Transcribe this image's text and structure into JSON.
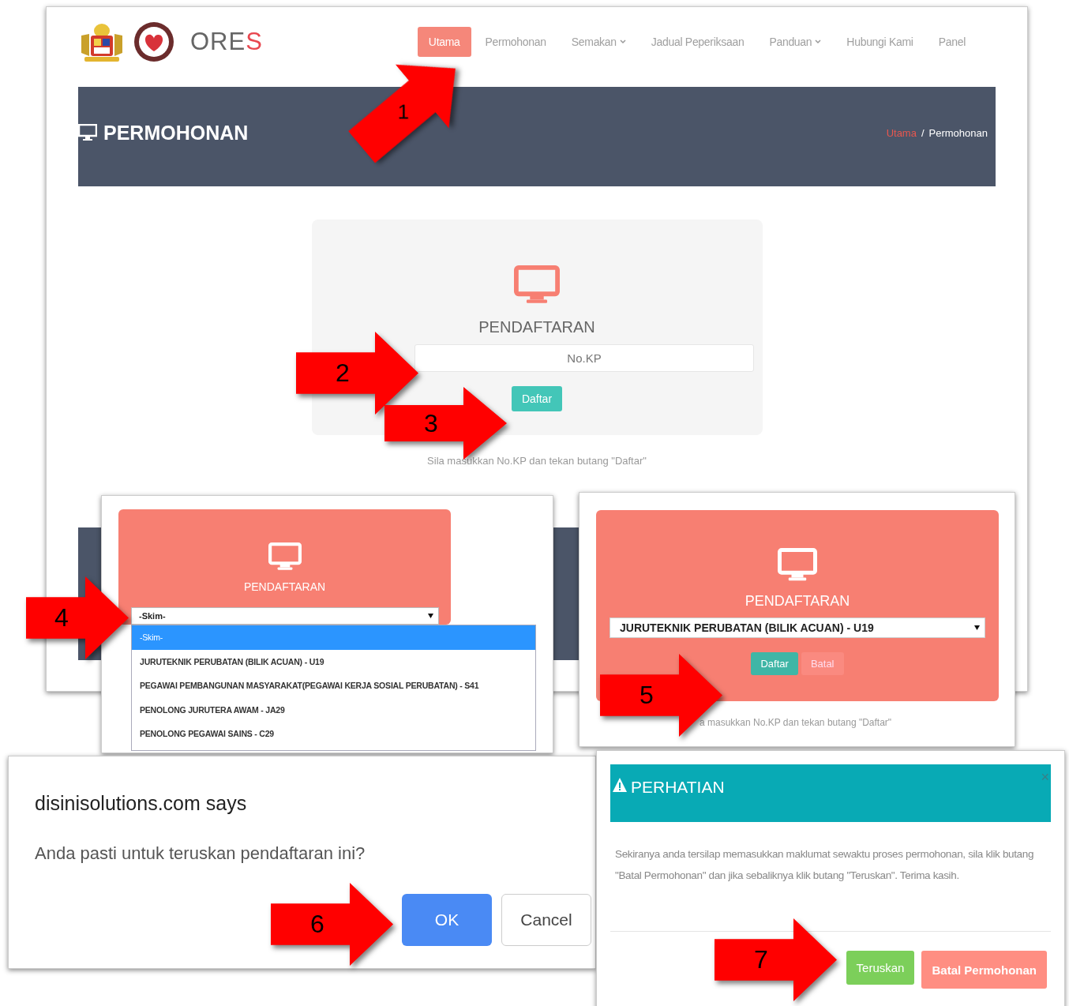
{
  "page": {
    "brand": "ORE",
    "brand_accent": "S",
    "nav": [
      {
        "label": "Utama",
        "selected": true,
        "dropdown": false
      },
      {
        "label": "Permohonan",
        "selected": false,
        "dropdown": false
      },
      {
        "label": "Semakan",
        "selected": false,
        "dropdown": true
      },
      {
        "label": "Jadual Peperiksaan",
        "selected": false,
        "dropdown": false
      },
      {
        "label": "Panduan",
        "selected": false,
        "dropdown": true
      },
      {
        "label": "Hubungi Kami",
        "selected": false,
        "dropdown": false
      },
      {
        "label": "Panel",
        "selected": false,
        "dropdown": false
      }
    ],
    "banner": {
      "title": "PERMOHONAN",
      "breadcrumb": [
        {
          "label": "Utama",
          "kind": "link"
        },
        {
          "label": "/",
          "kind": "separator"
        },
        {
          "label": "Permohonan",
          "kind": "current"
        }
      ]
    },
    "card": {
      "title": "PENDAFTARAN",
      "field": {
        "placeholder": "No.KP"
      },
      "button": "Daftar"
    },
    "hint": "Sila masukkan No.KP dan tekan butang \"Daftar\""
  },
  "dropdown_view": {
    "title": "PENDAFTARAN",
    "select_value": "-Skim-",
    "options": [
      {
        "label": "-Skim-",
        "selected": true
      },
      {
        "label": "JURUTEKNIK PERUBATAN (BILIK ACUAN) - U19",
        "selected": false
      },
      {
        "label": "PEGAWAI PEMBANGUNAN MASYARAKAT(PEGAWAI KERJA SOSIAL PERUBATAN) - S41",
        "selected": false
      },
      {
        "label": "PENOLONG JURUTERA AWAM - JA29",
        "selected": false
      },
      {
        "label": "PENOLONG PEGAWAI SAINS - C29",
        "selected": false
      }
    ]
  },
  "selected_view": {
    "title": "PENDAFTARAN",
    "select_value": "JURUTEKNIK PERUBATAN (BILIK ACUAN) - U19",
    "buttons": [
      {
        "label": "Daftar",
        "kind": "primary"
      },
      {
        "label": "Batal",
        "kind": "danger"
      }
    ],
    "hint": "a masukkan No.KP dan tekan butang \"Daftar\""
  },
  "confirm_dialog": {
    "title": "disinisolutions.com says",
    "message": "Anda pasti untuk teruskan pendaftaran ini?",
    "buttons": [
      {
        "label": "OK",
        "kind": "primary"
      },
      {
        "label": "Cancel",
        "kind": "secondary"
      }
    ]
  },
  "notice_modal": {
    "title": "PERHATIAN",
    "close": "×",
    "message": "Sekiranya anda tersilap memasukkan maklumat sewaktu proses permohonan, sila klik butang \"Batal Permohonan\" dan jika sebaliknya klik butang \"Teruskan\". Terima kasih.",
    "buttons": [
      {
        "label": "Teruskan",
        "kind": "success"
      },
      {
        "label": "Batal Permohonan",
        "kind": "danger"
      }
    ]
  },
  "callouts": [
    {
      "number": "1"
    },
    {
      "number": "2"
    },
    {
      "number": "3"
    },
    {
      "number": "4"
    },
    {
      "number": "5"
    },
    {
      "number": "6"
    },
    {
      "number": "7"
    }
  ]
}
